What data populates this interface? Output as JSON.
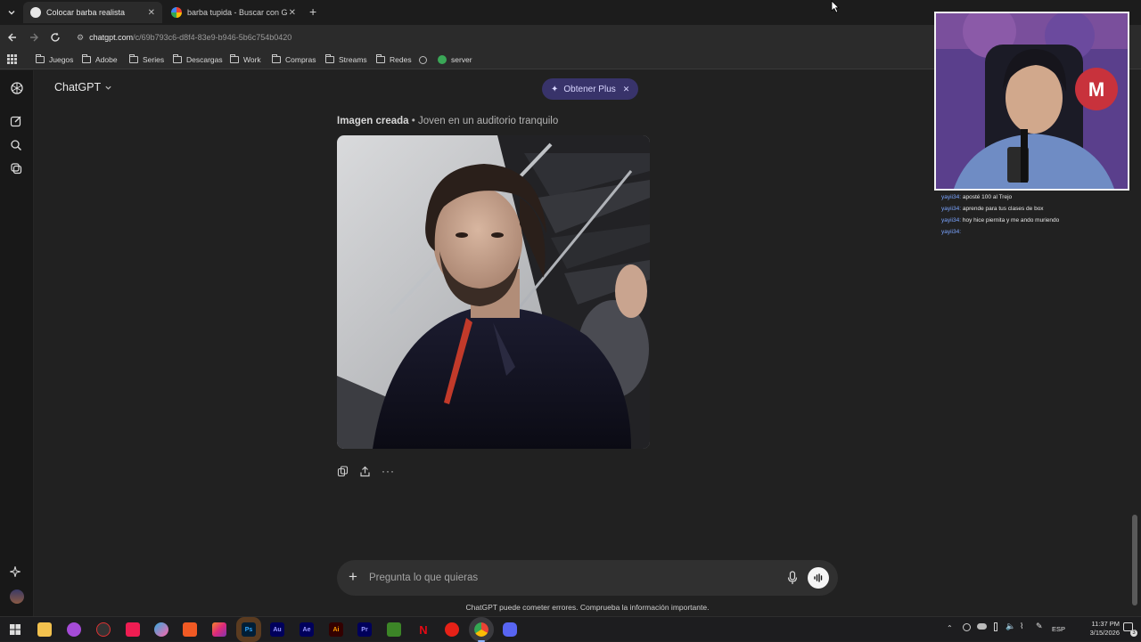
{
  "browser": {
    "tabs": [
      {
        "title": "Colocar barba realista",
        "active": true
      },
      {
        "title": "barba tupida - Buscar con Goo",
        "active": false
      }
    ],
    "url_host": "chatgpt.com",
    "url_path": "/c/69b793c6-d8f4-83e9-b946-5b6c754b0420",
    "bookmarks": [
      "Juegos",
      "Adobe",
      "Series",
      "Descargas",
      "Work",
      "Compras",
      "Streams",
      "Redes",
      "server"
    ]
  },
  "app": {
    "model_name": "ChatGPT",
    "upgrade_label": "Obtener Plus",
    "image_caption_bold": "Imagen creada",
    "image_caption_rest": " • Joven en un auditorio tranquilo",
    "composer_placeholder": "Pregunta lo que quieras",
    "disclaimer": "ChatGPT puede cometer errores. Comprueba la información importante."
  },
  "chat_overlay": [
    {
      "user": "yayii34:",
      "text": "aposté 100 al Trejo"
    },
    {
      "user": "yayii34:",
      "text": "aprende para tus clases de box"
    },
    {
      "user": "yayii34:",
      "text": "hoy hice piernita y me ando muriendo"
    },
    {
      "user": "yayii34:",
      "text": ""
    }
  ],
  "taskbar": {
    "language": "ESP",
    "time": "11:37 PM",
    "date": "3/15/2026",
    "notification_count": "3",
    "apps": [
      "Ps",
      "Au",
      "Ae",
      "Ai",
      "Pr"
    ]
  },
  "colors": {
    "accent_plus": "#38336a",
    "background": "#212121",
    "chat_username": "#7aa4ff"
  }
}
